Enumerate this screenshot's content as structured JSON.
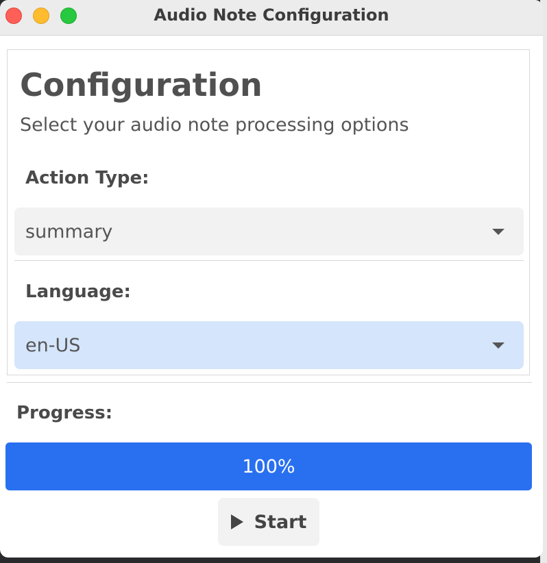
{
  "window": {
    "title": "Audio Note Configuration"
  },
  "config": {
    "title": "Configuration",
    "subtitle": "Select your audio note processing options",
    "action_type": {
      "label": "Action Type:",
      "value": "summary"
    },
    "language": {
      "label": "Language:",
      "value": "en-US"
    }
  },
  "progress": {
    "label": "Progress:",
    "percent_text": "100%",
    "fraction": 1.0
  },
  "start_button": {
    "label": "Start",
    "icon": "play-icon"
  },
  "colors": {
    "accent": "#2970f0",
    "language_select_bg": "#d5e5fb",
    "close": "#fe5f57",
    "minimize": "#febc2e",
    "maximize": "#28c840"
  }
}
